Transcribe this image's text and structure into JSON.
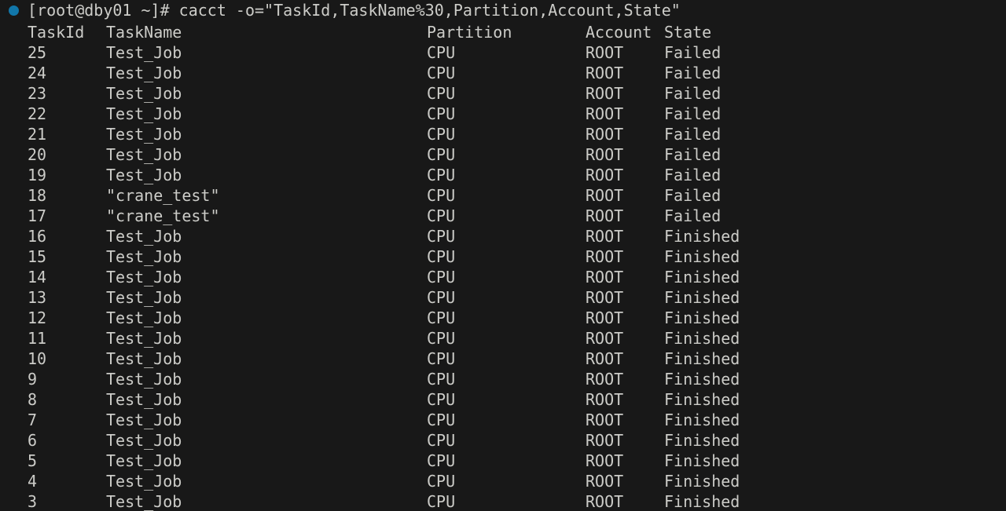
{
  "terminal": {
    "background_color": "#181818",
    "text_color": "#ccccc8",
    "marker_color": "#1177aa",
    "prompt": "[root@dby01 ~]# cacct -o=\"TaskId,TaskName%30,Partition,Account,State\"",
    "prompt_user_host": "[root@dby01 ~]#",
    "command": "cacct -o=\"TaskId,TaskName%30,Partition,Account,State\"",
    "marker_icon": "status-dot-icon"
  },
  "table": {
    "headers": {
      "taskid": "TaskId",
      "taskname": "TaskName",
      "partition": "Partition",
      "account": "Account",
      "state": "State"
    },
    "rows": [
      {
        "taskid": "25",
        "taskname": "Test_Job",
        "partition": "CPU",
        "account": "ROOT",
        "state": "Failed"
      },
      {
        "taskid": "24",
        "taskname": "Test_Job",
        "partition": "CPU",
        "account": "ROOT",
        "state": "Failed"
      },
      {
        "taskid": "23",
        "taskname": "Test_Job",
        "partition": "CPU",
        "account": "ROOT",
        "state": "Failed"
      },
      {
        "taskid": "22",
        "taskname": "Test_Job",
        "partition": "CPU",
        "account": "ROOT",
        "state": "Failed"
      },
      {
        "taskid": "21",
        "taskname": "Test_Job",
        "partition": "CPU",
        "account": "ROOT",
        "state": "Failed"
      },
      {
        "taskid": "20",
        "taskname": "Test_Job",
        "partition": "CPU",
        "account": "ROOT",
        "state": "Failed"
      },
      {
        "taskid": "19",
        "taskname": "Test_Job",
        "partition": "CPU",
        "account": "ROOT",
        "state": "Failed"
      },
      {
        "taskid": "18",
        "taskname": "\"crane_test\"",
        "partition": "CPU",
        "account": "ROOT",
        "state": "Failed"
      },
      {
        "taskid": "17",
        "taskname": "\"crane_test\"",
        "partition": "CPU",
        "account": "ROOT",
        "state": "Failed"
      },
      {
        "taskid": "16",
        "taskname": "Test_Job",
        "partition": "CPU",
        "account": "ROOT",
        "state": "Finished"
      },
      {
        "taskid": "15",
        "taskname": "Test_Job",
        "partition": "CPU",
        "account": "ROOT",
        "state": "Finished"
      },
      {
        "taskid": "14",
        "taskname": "Test_Job",
        "partition": "CPU",
        "account": "ROOT",
        "state": "Finished"
      },
      {
        "taskid": "13",
        "taskname": "Test_Job",
        "partition": "CPU",
        "account": "ROOT",
        "state": "Finished"
      },
      {
        "taskid": "12",
        "taskname": "Test_Job",
        "partition": "CPU",
        "account": "ROOT",
        "state": "Finished"
      },
      {
        "taskid": "11",
        "taskname": "Test_Job",
        "partition": "CPU",
        "account": "ROOT",
        "state": "Finished"
      },
      {
        "taskid": "10",
        "taskname": "Test_Job",
        "partition": "CPU",
        "account": "ROOT",
        "state": "Finished"
      },
      {
        "taskid": "9",
        "taskname": "Test_Job",
        "partition": "CPU",
        "account": "ROOT",
        "state": "Finished"
      },
      {
        "taskid": "8",
        "taskname": "Test_Job",
        "partition": "CPU",
        "account": "ROOT",
        "state": "Finished"
      },
      {
        "taskid": "7",
        "taskname": "Test_Job",
        "partition": "CPU",
        "account": "ROOT",
        "state": "Finished"
      },
      {
        "taskid": "6",
        "taskname": "Test_Job",
        "partition": "CPU",
        "account": "ROOT",
        "state": "Finished"
      },
      {
        "taskid": "5",
        "taskname": "Test_Job",
        "partition": "CPU",
        "account": "ROOT",
        "state": "Finished"
      },
      {
        "taskid": "4",
        "taskname": "Test_Job",
        "partition": "CPU",
        "account": "ROOT",
        "state": "Finished"
      },
      {
        "taskid": "3",
        "taskname": "Test_Job",
        "partition": "CPU",
        "account": "ROOT",
        "state": "Finished"
      }
    ]
  }
}
